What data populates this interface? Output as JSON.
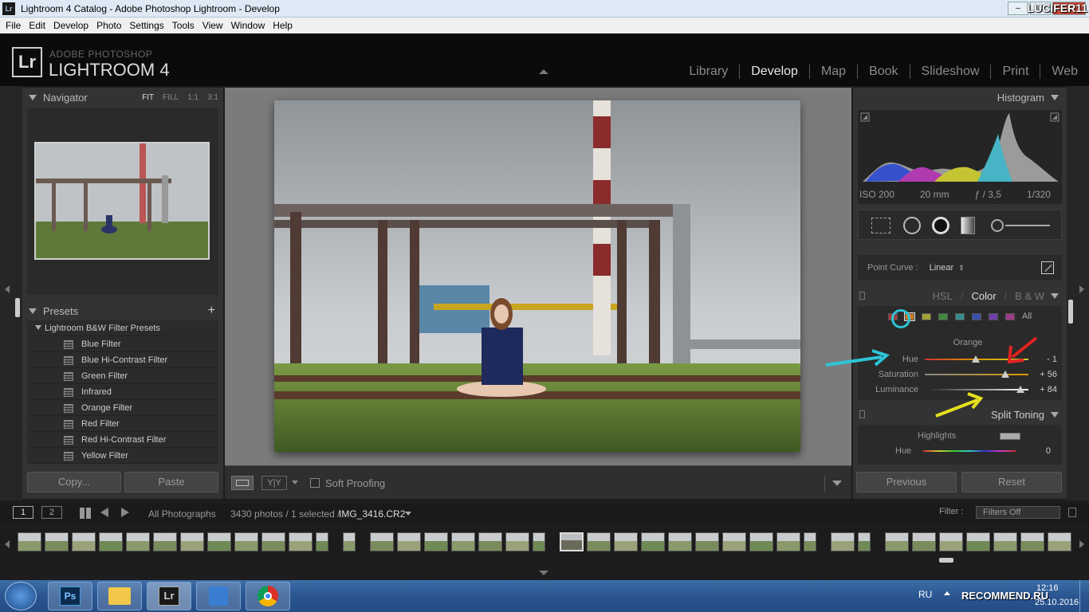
{
  "window": {
    "title": "Lightroom 4 Catalog - Adobe Photoshop Lightroom - Develop",
    "app_icon_text": "Lr"
  },
  "watermark": "LUCIFER11",
  "menu": [
    "File",
    "Edit",
    "Develop",
    "Photo",
    "Settings",
    "Tools",
    "View",
    "Window",
    "Help"
  ],
  "brand": {
    "logo": "Lr",
    "sub": "ADOBE PHOTOSHOP",
    "name": "LIGHTROOM 4"
  },
  "modules": [
    "Library",
    "Develop",
    "Map",
    "Book",
    "Slideshow",
    "Print",
    "Web"
  ],
  "active_module": "Develop",
  "navigator": {
    "title": "Navigator",
    "options": [
      "FIT",
      "FILL",
      "1:1",
      "3:1"
    ],
    "active": "FIT"
  },
  "presets": {
    "title": "Presets",
    "add": "+",
    "folder": "Lightroom B&W Filter Presets",
    "items": [
      "Blue Filter",
      "Blue Hi-Contrast Filter",
      "Green Filter",
      "Infrared",
      "Orange Filter",
      "Red Filter",
      "Red Hi-Contrast Filter",
      "Yellow Filter"
    ]
  },
  "left_buttons": {
    "copy": "Copy...",
    "paste": "Paste"
  },
  "toolbar": {
    "soft_proofing": "Soft Proofing",
    "compare": "Y|Y"
  },
  "histogram": {
    "title": "Histogram",
    "iso": "ISO 200",
    "focal": "20 mm",
    "aperture": "ƒ / 3,5",
    "shutter": "1/320"
  },
  "tone_curve": {
    "label": "Point Curve :",
    "value": "Linear"
  },
  "hsl": {
    "tabs": [
      "HSL",
      "Color",
      "B & W"
    ],
    "active": "Color",
    "swatches": [
      "#a13a37",
      "#d07a1d",
      "#a3a33a",
      "#3f8a3f",
      "#3a8c8c",
      "#3a4fa8",
      "#6d3fa8",
      "#9c3b86"
    ],
    "swatch_all": "All",
    "selected_color": "Orange",
    "sliders": [
      {
        "label": "Hue",
        "value": "- 1",
        "level": 0.49
      },
      {
        "label": "Saturation",
        "value": "+ 56",
        "level": 0.78
      },
      {
        "label": "Luminance",
        "value": "+ 84",
        "level": 0.92
      }
    ]
  },
  "split_toning": {
    "title": "Split Toning",
    "highlights": "Highlights",
    "hue_label": "Hue",
    "hue_value": "0"
  },
  "right_buttons": {
    "previous": "Previous",
    "reset": "Reset"
  },
  "filmbar": {
    "screen1": "1",
    "screen2": "2",
    "source": "All Photographs",
    "count": "3430 photos / 1 selected /",
    "filename": "IMG_3416.CR2",
    "filter_label": "Filter :",
    "filter_value": "Filters Off"
  },
  "taskbar": {
    "lang": "RU",
    "time": "12:16",
    "date": "25.10.2016",
    "recommend": "RECOMMEND.RU"
  }
}
